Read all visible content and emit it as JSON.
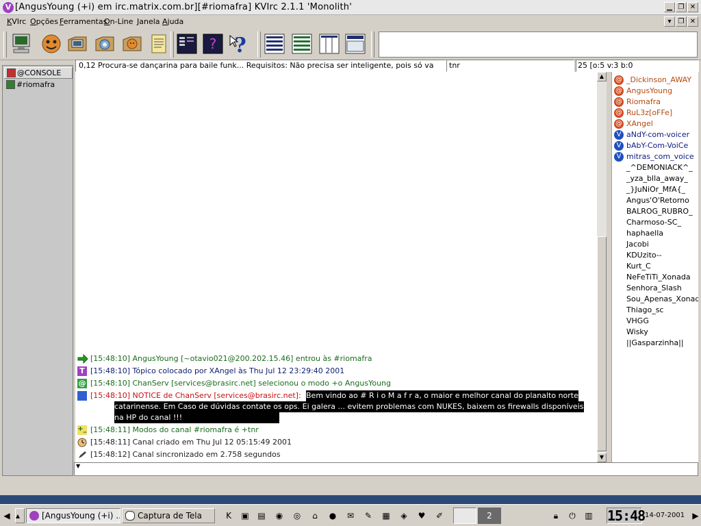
{
  "window": {
    "title": "[AngusYoung (+i) em irc.matrix.com.br][#riomafra] KVIrc 2.1.1 'Monolith'",
    "app_icon": "V",
    "controls": [
      "minimize-icon",
      "maximize-icon",
      "close-icon"
    ]
  },
  "menu": [
    "KVIrc",
    "Opções",
    "Ferramentas",
    "On-Line",
    "Janela",
    "Ajuda"
  ],
  "toolbar": {
    "buttons": [
      "monitor-icon",
      "face-icon",
      "computer-icon",
      "gear-icon",
      "user-icon",
      "notes-icon",
      "terminal-icon",
      "script-icon",
      "help-icon",
      "layout-1-icon",
      "layout-2-icon",
      "layout-3-icon",
      "layout-4-icon"
    ]
  },
  "windows": [
    {
      "label": "@CONSOLE",
      "active": true
    },
    {
      "label": "#riomafra",
      "active": false
    }
  ],
  "topic": {
    "text": "0,12 Procura-se dançarina para baile funk... Requisitos: Não precisa ser inteligente, pois só va",
    "secondary": "tnr",
    "mode": "25 [o:5 v:3 b:0"
  },
  "messages": [
    {
      "icon": "join-icon",
      "color": "#1a6b1a",
      "text": "[15:48:10] AngusYoung [~otavio021@200.202.15.46] entrou às #riomafra"
    },
    {
      "icon": "topic-icon",
      "color": "#102070",
      "text": "[15:48:10] Tópico colocado por XAngel às Thu Jul 12 23:29:40 2001"
    },
    {
      "icon": "op-icon",
      "color": "#1a6b1a",
      "text": "[15:48:10] ChanServ [services@brasirc.net] selecionou o modo +o AngusYoung"
    },
    {
      "icon": "notice-icon",
      "color": "#c41010",
      "text": "[15:48:10] NOTICE de ChanServ [services@brasirc.net]:",
      "highlight": "Bem vindo ao # R i o M a f r a, o maior e melhor canal do planalto norte"
    },
    {
      "icon": "",
      "color": "#fff",
      "text": "",
      "highlight": "catarinense. Em Caso de dúvidas contate os ops. Ei galera ... evitem problemas com NUKES, baixem os firewalls disponíveis"
    },
    {
      "icon": "",
      "color": "#fff",
      "text": "",
      "highlight": "na HP do canal !!!"
    },
    {
      "icon": "mode-icon",
      "color": "#1a6b1a",
      "text": "[15:48:11] Modos do canal #riomafra é +tnr"
    },
    {
      "icon": "clock-icon",
      "color": "#222",
      "text": "[15:48:11] Canal criado em Thu Jul 12 05:15:49 2001"
    },
    {
      "icon": "pencil-icon",
      "color": "#222",
      "text": "[15:48:12] Canal sincronizado em 2.758 segundos"
    }
  ],
  "users": [
    {
      "name": "_Dickinson_AWAY",
      "type": "op"
    },
    {
      "name": "AngusYoung",
      "type": "op"
    },
    {
      "name": "Riomafra",
      "type": "op"
    },
    {
      "name": "RuL3z[oFFe]",
      "type": "op"
    },
    {
      "name": "XAngel",
      "type": "op"
    },
    {
      "name": "aNdY-com-voicer",
      "type": "voice"
    },
    {
      "name": "bAbY-Com-VoiCe",
      "type": "voice"
    },
    {
      "name": "mitras_com_voice",
      "type": "voice"
    },
    {
      "name": "_^DEMONIACK^_",
      "type": "normal"
    },
    {
      "name": "_yza_blla_away_",
      "type": "normal"
    },
    {
      "name": "_}JuNiOr_MfA{_",
      "type": "normal"
    },
    {
      "name": "Angus'O'Retorno",
      "type": "normal"
    },
    {
      "name": "BALROG_RUBRO_",
      "type": "normal"
    },
    {
      "name": "Charmoso-SC_",
      "type": "normal"
    },
    {
      "name": "haphaella",
      "type": "normal"
    },
    {
      "name": "Jacobi",
      "type": "normal"
    },
    {
      "name": "KDUzito--",
      "type": "normal"
    },
    {
      "name": "Kurt_C",
      "type": "normal"
    },
    {
      "name": "NeFeTiTi_Xonada",
      "type": "normal"
    },
    {
      "name": "Senhora_Slash",
      "type": "normal"
    },
    {
      "name": "Sou_Apenas_Xonada",
      "type": "normal"
    },
    {
      "name": "Thiago_sc",
      "type": "normal"
    },
    {
      "name": "VHGG",
      "type": "normal"
    },
    {
      "name": "Wisky",
      "type": "normal"
    },
    {
      "name": "||Gasparzinha||",
      "type": "normal"
    }
  ],
  "taskbar": {
    "tasks": [
      "[AngusYoung (+i) ...",
      "Captura de Tela"
    ],
    "desktop_number": "2",
    "clock": "15:48",
    "date": "14-07-2001"
  },
  "colors": {
    "op": "#b44a10",
    "voice": "#102080",
    "join": "#1a6b1a",
    "notice": "#c41010",
    "desktop": "#2b4a78"
  }
}
